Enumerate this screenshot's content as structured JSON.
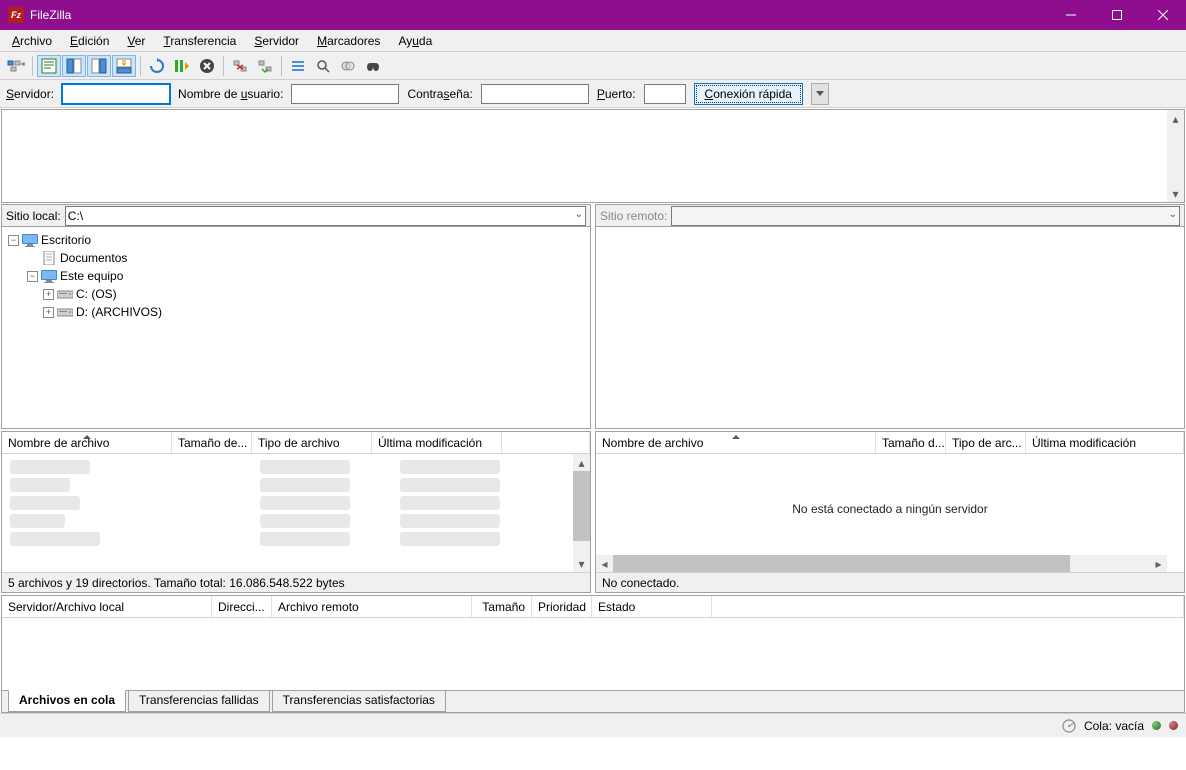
{
  "title": "FileZilla",
  "menu": [
    "Archivo",
    "Edición",
    "Ver",
    "Transferencia",
    "Servidor",
    "Marcadores",
    "Ayuda"
  ],
  "quickconnect": {
    "server_label": "Servidor:",
    "user_label": "Nombre de usuario:",
    "pass_label": "Contraseña:",
    "port_label": "Puerto:",
    "button": "Conexión rápida"
  },
  "local": {
    "path_label": "Sitio local:",
    "path_value": "C:\\",
    "tree": {
      "desktop": "Escritorio",
      "documents": "Documentos",
      "thispc": "Este equipo",
      "drive_c": "C: (OS)",
      "drive_d": "D: (ARCHIVOS)"
    },
    "columns": [
      "Nombre de archivo",
      "Tamaño de...",
      "Tipo de archivo",
      "Última modificación"
    ],
    "status": "5 archivos y 19 directorios. Tamaño total: 16.086.548.522 bytes"
  },
  "remote": {
    "path_label": "Sitio remoto:",
    "columns": [
      "Nombre de archivo",
      "Tamaño d...",
      "Tipo de arc...",
      "Última modificación"
    ],
    "empty_msg": "No está conectado a ningún servidor",
    "status": "No conectado."
  },
  "queue": {
    "columns": [
      "Servidor/Archivo local",
      "Direcci...",
      "Archivo remoto",
      "Tamaño",
      "Prioridad",
      "Estado"
    ],
    "tabs": [
      "Archivos en cola",
      "Transferencias fallidas",
      "Transferencias satisfactorias"
    ]
  },
  "statusbar": {
    "queue": "Cola: vacía"
  }
}
